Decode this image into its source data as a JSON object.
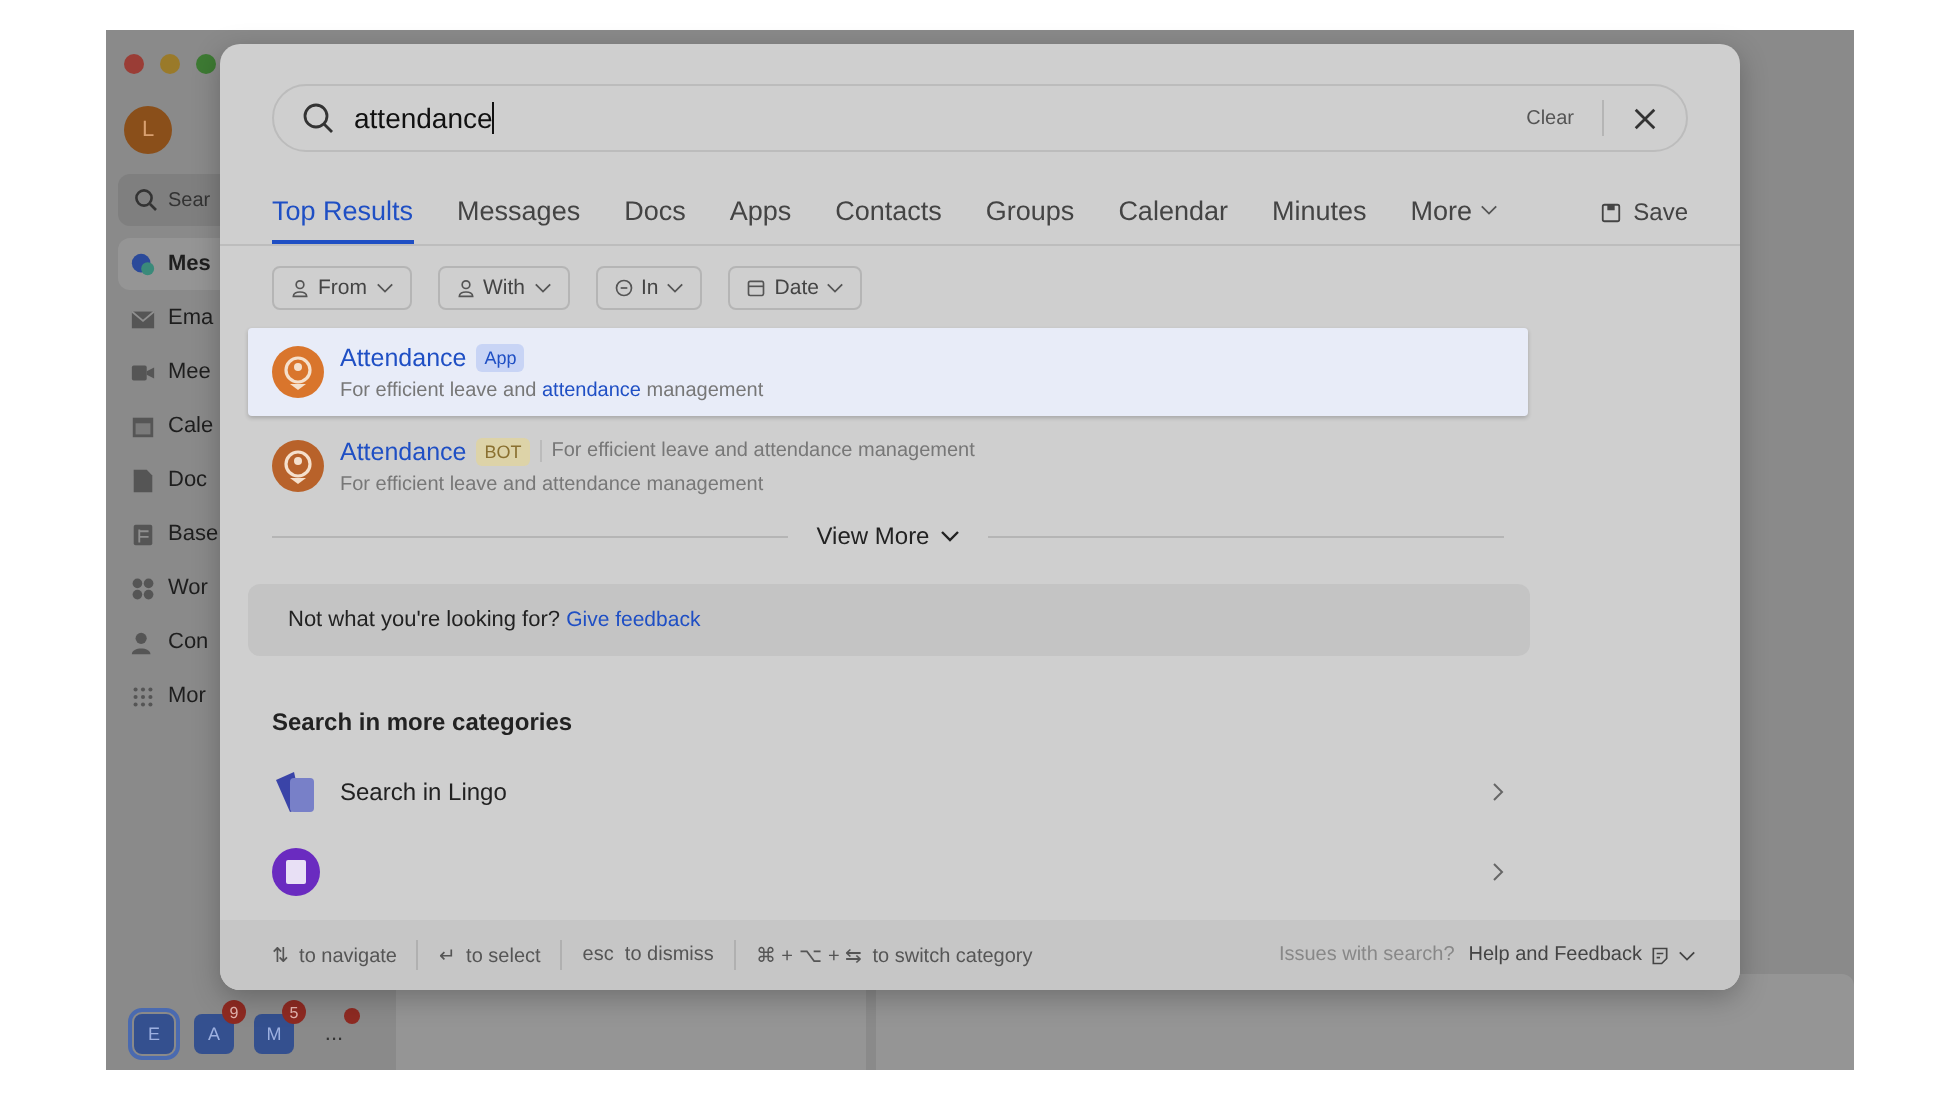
{
  "app": {
    "avatar": "L",
    "search_placeholder": "Sear",
    "nav": [
      {
        "label": "Mes",
        "selected": true
      },
      {
        "label": "Ema",
        "selected": false
      },
      {
        "label": "Mee",
        "selected": false
      },
      {
        "label": "Cale",
        "selected": false
      },
      {
        "label": "Doc",
        "selected": false
      },
      {
        "label": "Base",
        "selected": false
      },
      {
        "label": "Wor",
        "selected": false
      },
      {
        "label": "Con",
        "selected": false
      },
      {
        "label": "Mor",
        "selected": false
      }
    ],
    "dock": [
      {
        "label": "E",
        "selected": true
      },
      {
        "label": "A",
        "badge": "9",
        "selected": false
      },
      {
        "label": "M",
        "badge": "5",
        "selected": false
      }
    ],
    "more": "..."
  },
  "search": {
    "value": "attendance",
    "clear": "Clear"
  },
  "tabs": [
    {
      "label": "Top Results",
      "selected": true
    },
    {
      "label": "Messages",
      "selected": false
    },
    {
      "label": "Docs",
      "selected": false
    },
    {
      "label": "Apps",
      "selected": false
    },
    {
      "label": "Contacts",
      "selected": false
    },
    {
      "label": "Groups",
      "selected": false
    },
    {
      "label": "Calendar",
      "selected": false
    },
    {
      "label": "Minutes",
      "selected": false
    },
    {
      "label": "More",
      "selected": false,
      "kind": "dropdown"
    }
  ],
  "save": "Save",
  "filters": [
    {
      "label": "From"
    },
    {
      "label": "With"
    },
    {
      "label": "In"
    },
    {
      "label": "Date"
    }
  ],
  "results": [
    {
      "title": "Attendance",
      "tag": "App",
      "kind": "app",
      "selected": true,
      "desc": [
        {
          "text": "For efficient leave and ",
          "hit": false
        },
        {
          "text": "attendance",
          "hit": true
        },
        {
          "text": " management",
          "hit": false
        }
      ]
    },
    {
      "title": "Attendance",
      "tag": "BOT",
      "kind": "bot",
      "selected": false,
      "side": "For efficient leave and attendance management",
      "desc": [
        {
          "text": "For efficient leave and attendance management",
          "hit": false
        }
      ]
    }
  ],
  "view_more": "View More",
  "feedback": {
    "text": "Not what you're looking for?",
    "link": "Give feedback"
  },
  "categories_title": "Search in more categories",
  "categories": [
    {
      "label": "Search in Lingo"
    }
  ],
  "footer": {
    "hints": [
      {
        "keys": "⇅",
        "text": "to navigate"
      },
      {
        "keys": "↵",
        "text": "to select"
      },
      {
        "keys": "esc",
        "text": "to dismiss"
      },
      {
        "keys": "⌘ + ⌥ + ⇆",
        "text": "to switch category"
      }
    ],
    "issues": "Issues with search?",
    "help": "Help and Feedback"
  }
}
